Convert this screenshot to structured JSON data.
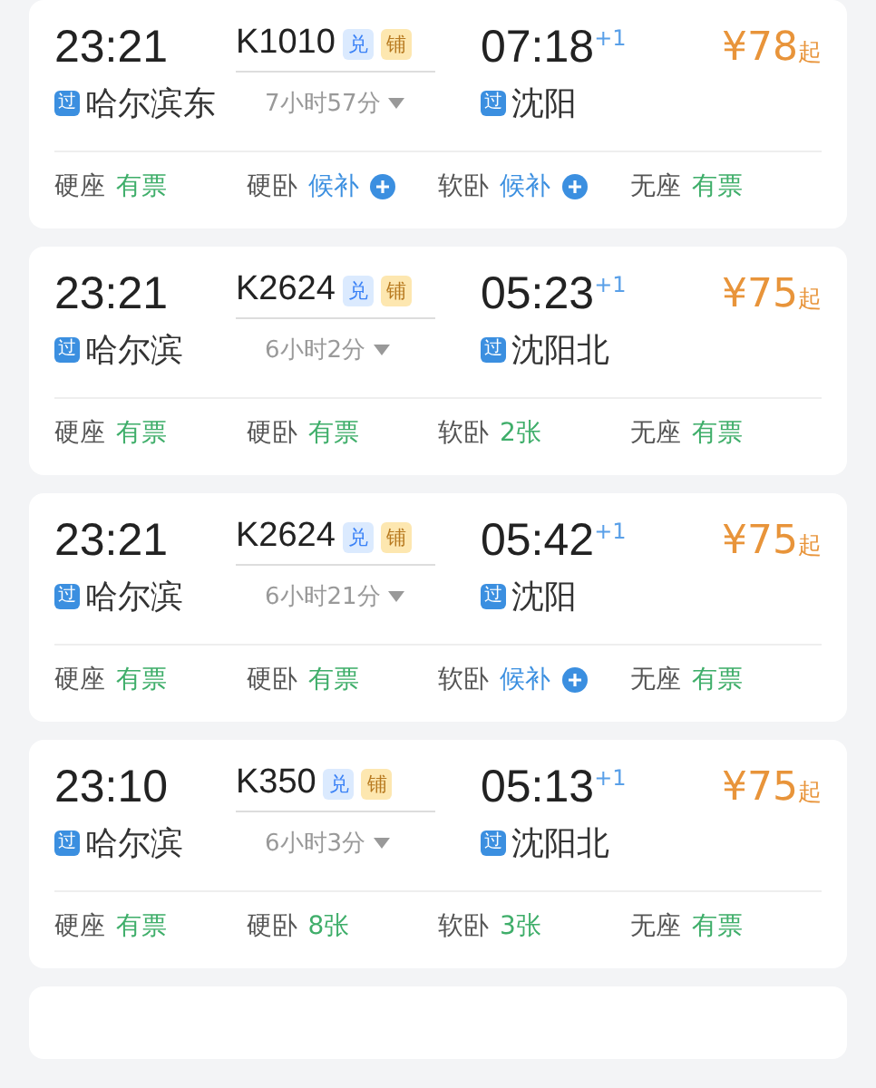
{
  "trains": [
    {
      "depart": "23:21",
      "train_no": "K1010",
      "tags": [
        "兑",
        "铺"
      ],
      "arrive": "07:18",
      "day_offset": "+1",
      "price": "¥78",
      "price_suffix": "起",
      "from_mark": "过",
      "from": "哈尔滨东",
      "duration": "7小时57分",
      "to_mark": "过",
      "to": "沈阳",
      "seats": [
        {
          "name": "硬座",
          "status": "有票",
          "kind": "available"
        },
        {
          "name": "硬卧",
          "status": "候补",
          "kind": "waitlist"
        },
        {
          "name": "软卧",
          "status": "候补",
          "kind": "waitlist"
        },
        {
          "name": "无座",
          "status": "有票",
          "kind": "available"
        }
      ]
    },
    {
      "depart": "23:21",
      "train_no": "K2624",
      "tags": [
        "兑",
        "铺"
      ],
      "arrive": "05:23",
      "day_offset": "+1",
      "price": "¥75",
      "price_suffix": "起",
      "from_mark": "过",
      "from": "哈尔滨",
      "duration": "6小时2分",
      "to_mark": "过",
      "to": "沈阳北",
      "seats": [
        {
          "name": "硬座",
          "status": "有票",
          "kind": "available"
        },
        {
          "name": "硬卧",
          "status": "有票",
          "kind": "available"
        },
        {
          "name": "软卧",
          "status": "2张",
          "kind": "available"
        },
        {
          "name": "无座",
          "status": "有票",
          "kind": "available"
        }
      ]
    },
    {
      "depart": "23:21",
      "train_no": "K2624",
      "tags": [
        "兑",
        "铺"
      ],
      "arrive": "05:42",
      "day_offset": "+1",
      "price": "¥75",
      "price_suffix": "起",
      "from_mark": "过",
      "from": "哈尔滨",
      "duration": "6小时21分",
      "to_mark": "过",
      "to": "沈阳",
      "seats": [
        {
          "name": "硬座",
          "status": "有票",
          "kind": "available"
        },
        {
          "name": "硬卧",
          "status": "有票",
          "kind": "available"
        },
        {
          "name": "软卧",
          "status": "候补",
          "kind": "waitlist"
        },
        {
          "name": "无座",
          "status": "有票",
          "kind": "available"
        }
      ]
    },
    {
      "depart": "23:10",
      "train_no": "K350",
      "tags": [
        "兑",
        "铺"
      ],
      "arrive": "05:13",
      "day_offset": "+1",
      "price": "¥75",
      "price_suffix": "起",
      "from_mark": "过",
      "from": "哈尔滨",
      "duration": "6小时3分",
      "to_mark": "过",
      "to": "沈阳北",
      "seats": [
        {
          "name": "硬座",
          "status": "有票",
          "kind": "available"
        },
        {
          "name": "硬卧",
          "status": "8张",
          "kind": "available"
        },
        {
          "name": "软卧",
          "status": "3张",
          "kind": "available"
        },
        {
          "name": "无座",
          "status": "有票",
          "kind": "available"
        }
      ]
    }
  ]
}
